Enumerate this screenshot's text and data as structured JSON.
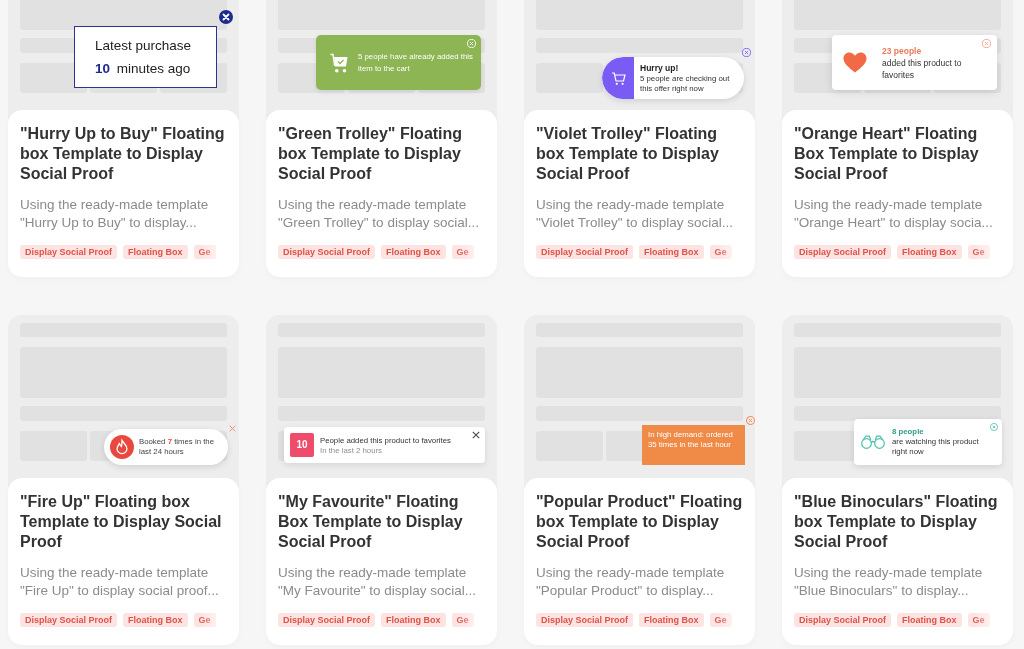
{
  "cards": [
    {
      "title": "\"Hurry Up to Buy\" Floating box Template to Display Social Proof",
      "description": "Using the ready-made template \"Hurry Up to Buy\" to display...",
      "tags": [
        "Display Social Proof",
        "Floating Box",
        "Ge"
      ],
      "preview": {
        "kind": "outlined-box",
        "heading": "Latest purchase",
        "count": "10",
        "text": "minutes ago"
      }
    },
    {
      "title": "\"Green Trolley\" Floating box Template to Display Social Proof",
      "description": "Using the ready-made template \"Green Trolley\" to display social...",
      "tags": [
        "Display Social Proof",
        "Floating Box",
        "Ge"
      ],
      "preview": {
        "kind": "green-cart",
        "text": "5 people have already added this item to the cart"
      }
    },
    {
      "title": "\"Violet Trolley\" Floating box Template to Display Social Proof",
      "description": "Using the ready-made template \"Violet Trolley\" to display social...",
      "tags": [
        "Display Social Proof",
        "Floating Box",
        "Ge"
      ],
      "preview": {
        "kind": "violet-pill",
        "heading": "Hurry up!",
        "text": "5 people are checking out this offer right now"
      }
    },
    {
      "title": "\"Orange Heart\" Floating Box Template to Display Social Proof",
      "description": "Using the ready-made template \"Orange Heart\" to display socia...",
      "tags": [
        "Display Social Proof",
        "Floating Box",
        "Ge"
      ],
      "preview": {
        "kind": "heart-card",
        "count": "23 people",
        "text": "added this product to favorites"
      }
    },
    {
      "title": "\"Fire Up\" Floating box Template to Display Social Proof",
      "description": "Using the ready-made template \"Fire Up\" to display social proof...",
      "tags": [
        "Display Social Proof",
        "Floating Box",
        "Ge"
      ],
      "preview": {
        "kind": "fire-pill",
        "lead": "Booked",
        "count": "7",
        "text": "times in the last 24 hours"
      }
    },
    {
      "title": "\"My Favourite\" Floating Box Template to Display Social Proof",
      "description": "Using the ready-made template \"My Favourite\" to display social...",
      "tags": [
        "Display Social Proof",
        "Floating Box",
        "Ge"
      ],
      "preview": {
        "kind": "count-badge",
        "count": "10",
        "text": "People added this product to favorites",
        "subtext": "In the last 2 hours"
      }
    },
    {
      "title": "\"Popular Product\" Floating box Template to Display Social Proof",
      "description": "Using the ready-made template \"Popular Product\" to display...",
      "tags": [
        "Display Social Proof",
        "Floating Box",
        "Ge"
      ],
      "preview": {
        "kind": "orange-note",
        "text": "In high demand: ordered 35 times in the last hour"
      }
    },
    {
      "title": "\"Blue Binoculars\" Floating box Template to Display Social Proof",
      "description": "Using the ready-made template \"Blue Binoculars\" to display...",
      "tags": [
        "Display Social Proof",
        "Floating Box",
        "Ge"
      ],
      "preview": {
        "kind": "binoculars-card",
        "count": "8 people",
        "text": "are watching this product right now"
      }
    }
  ]
}
